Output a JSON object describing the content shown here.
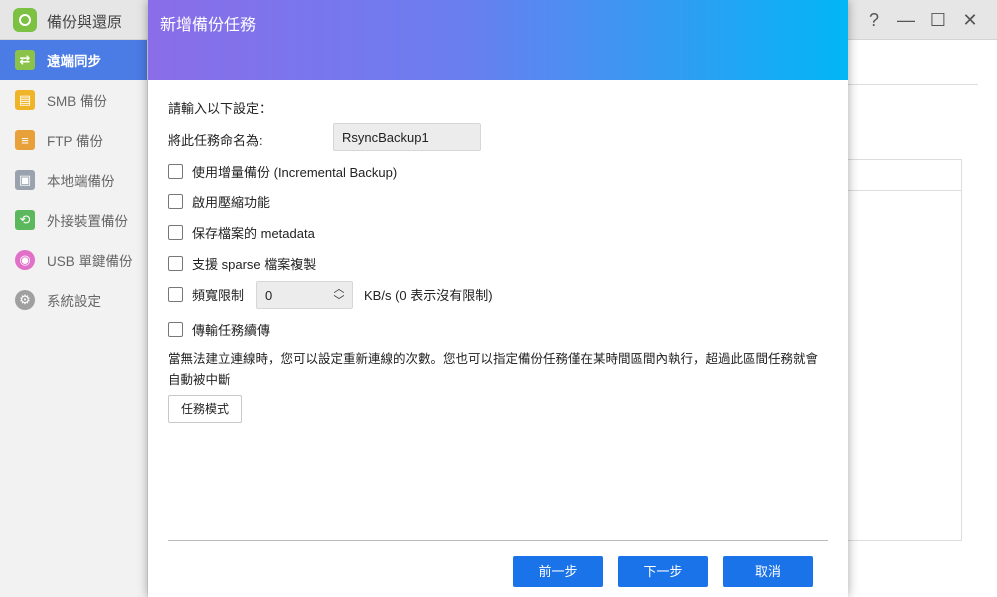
{
  "app": {
    "title": "備份與還原"
  },
  "window_controls": {
    "help": "?",
    "minimize": "—",
    "maximize": "☐",
    "close": "✕"
  },
  "sidebar": {
    "items": [
      {
        "label": "遠端同步",
        "icon": "sync-icon",
        "active": true
      },
      {
        "label": "SMB 備份",
        "icon": "smb-folder-icon"
      },
      {
        "label": "FTP 備份",
        "icon": "ftp-server-icon"
      },
      {
        "label": "本地端備份",
        "icon": "local-disk-icon"
      },
      {
        "label": "外接裝置備份",
        "icon": "external-device-icon"
      },
      {
        "label": "USB 單鍵備份",
        "icon": "usb-one-touch-icon"
      },
      {
        "label": "系統設定",
        "icon": "gear-icon"
      }
    ]
  },
  "dialog": {
    "title": "新增備份任務",
    "intro": "請輸入以下設定：",
    "name_label": "將此任務命名為:",
    "name_value": "RsyncBackup1",
    "options": {
      "incremental": "使用增量備份 (Incremental Backup)",
      "compression": "啟用壓縮功能",
      "metadata": "保存檔案的 metadata",
      "sparse": "支援 sparse 檔案複製",
      "bandwidth": "頻寬限制",
      "resume": "傳輸任務續傳"
    },
    "bandwidth_value": "0",
    "bandwidth_unit": "KB/s (0 表示沒有限制)",
    "hint": "當無法建立連線時，您可以設定重新連線的次數。您也可以指定備份任務僅在某時間區間內執行，超過此區間任務就會自動被中斷",
    "mode_button": "任務模式",
    "buttons": {
      "prev": "前一步",
      "next": "下一步",
      "cancel": "取消"
    }
  },
  "colors": {
    "accent": "#1a73e8",
    "sidebar_active": "#4b7be5",
    "header_gradient_start": "#8a6de8",
    "header_gradient_end": "#02b6f5"
  }
}
